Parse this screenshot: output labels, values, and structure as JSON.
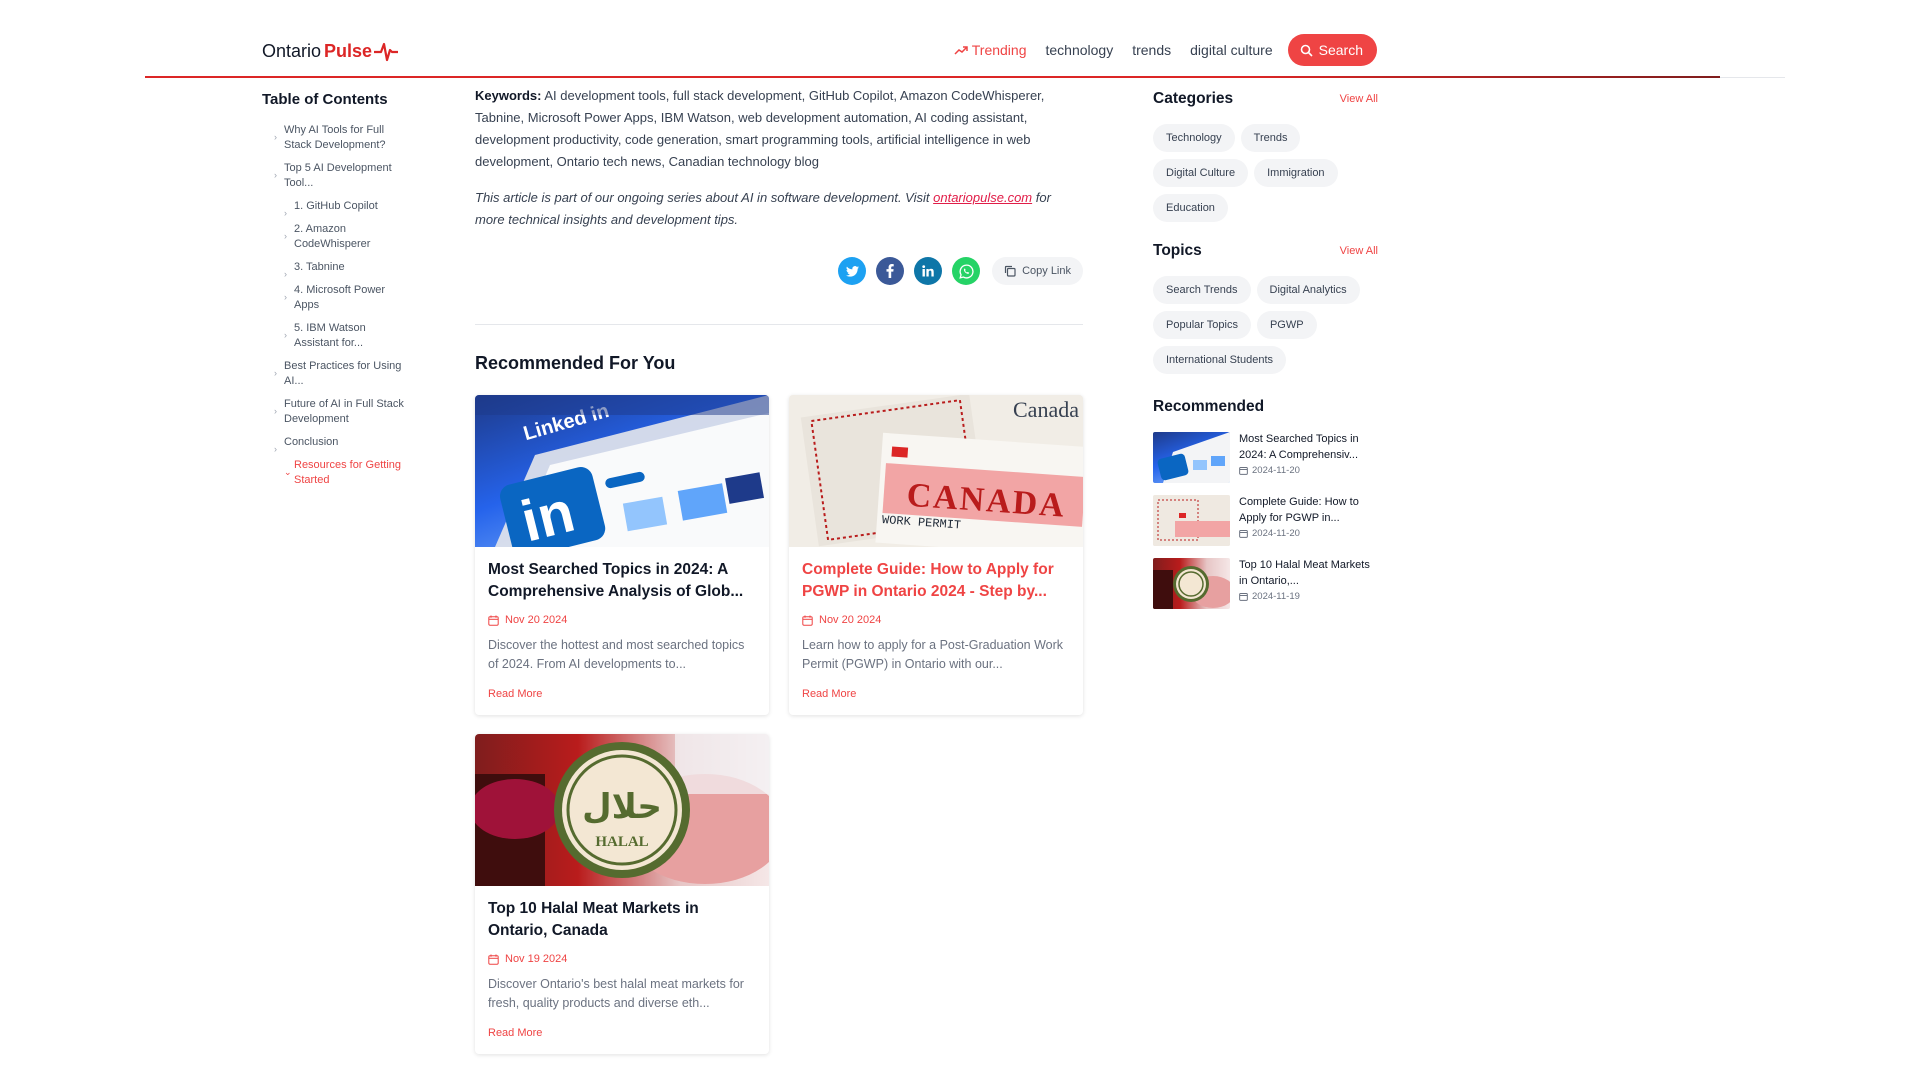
{
  "header": {
    "logo_word1": "Ontario",
    "logo_word2": "Pulse",
    "nav": {
      "trending": "Trending",
      "technology": "technology",
      "trends": "trends",
      "digital_culture": "digital culture"
    },
    "search_label": "Search"
  },
  "toc": {
    "title": "Table of Contents",
    "items": [
      "Why AI Tools for Full Stack Development?",
      "Top 5 AI Development Tool...",
      "1. GitHub Copilot",
      "2. Amazon CodeWhisperer",
      "3. Tabnine",
      "4. Microsoft Power Apps",
      "5. IBM Watson Assistant for...",
      "Best Practices for Using AI...",
      "Future of AI in Full Stack Development",
      "Conclusion",
      "Resources for Getting Started"
    ]
  },
  "article": {
    "keywords_label": "Keywords:",
    "keywords_text": " AI development tools, full stack development, GitHub Copilot, Amazon CodeWhisperer, Tabnine, Microsoft Power Apps, IBM Watson, web development automation, AI coding assistant, development productivity, code generation, smart programming tools, artificial intelligence in web development, Ontario tech news, Canadian technology blog",
    "series_prefix": "This article is part of our ongoing series about AI in software development. Visit ",
    "series_link": "ontariopulse.com",
    "series_suffix": " for more technical insights and development tips.",
    "copy_link": "Copy Link"
  },
  "recommended": {
    "title": "Recommended For You",
    "cards": [
      {
        "title": "Most Searched Topics in 2024: A Comprehensive Analysis of Glob...",
        "date": "Nov 20 2024",
        "desc": "Discover the hottest and most searched topics of 2024. From AI developments to...",
        "read_more": "Read More"
      },
      {
        "title": "Complete Guide: How to Apply for PGWP in Ontario 2024 - Step by...",
        "date": "Nov 20 2024",
        "desc": "Learn how to apply for a Post-Graduation Work Permit (PGWP) in Ontario with our...",
        "read_more": "Read More"
      },
      {
        "title": "Top 10 Halal Meat Markets in Ontario, Canada",
        "date": "Nov 19 2024",
        "desc": "Discover Ontario's best halal meat markets for fresh, quality products and diverse eth...",
        "read_more": "Read More"
      }
    ],
    "image_text": {
      "linkedin": "Linked in",
      "canada": "CANADA",
      "work_permit": "WORK PERMIT",
      "canada_wordmark": "Canada",
      "halal_ar": "حلال",
      "halal_en": "HALAL"
    }
  },
  "sidebar": {
    "categories": {
      "title": "Categories",
      "view_all": "View All",
      "items": [
        "Technology",
        "Trends",
        "Digital Culture",
        "Immigration",
        "Education"
      ]
    },
    "topics": {
      "title": "Topics",
      "view_all": "View All",
      "items": [
        "Search Trends",
        "Digital Analytics",
        "Popular Topics",
        "PGWP",
        "International Students"
      ]
    },
    "recommended": {
      "title": "Recommended",
      "items": [
        {
          "title": "Most Searched Topics in 2024: A Comprehensiv...",
          "date": "2024-11-20"
        },
        {
          "title": "Complete Guide: How to Apply for PGWP in...",
          "date": "2024-11-20"
        },
        {
          "title": "Top 10 Halal Meat Markets in Ontario,...",
          "date": "2024-11-19"
        }
      ]
    }
  },
  "colors": {
    "brand_red": "#ef4444",
    "twitter": "#1da1f2",
    "facebook": "#3b5998",
    "linkedin": "#0e76a8",
    "whatsapp": "#25d366"
  },
  "icons": [
    "pulse-logo-icon",
    "trending-up-icon",
    "search-icon",
    "chevron-right-icon",
    "chevron-down-icon",
    "twitter-icon",
    "facebook-icon",
    "linkedin-icon",
    "whatsapp-icon",
    "copy-icon",
    "calendar-icon"
  ]
}
